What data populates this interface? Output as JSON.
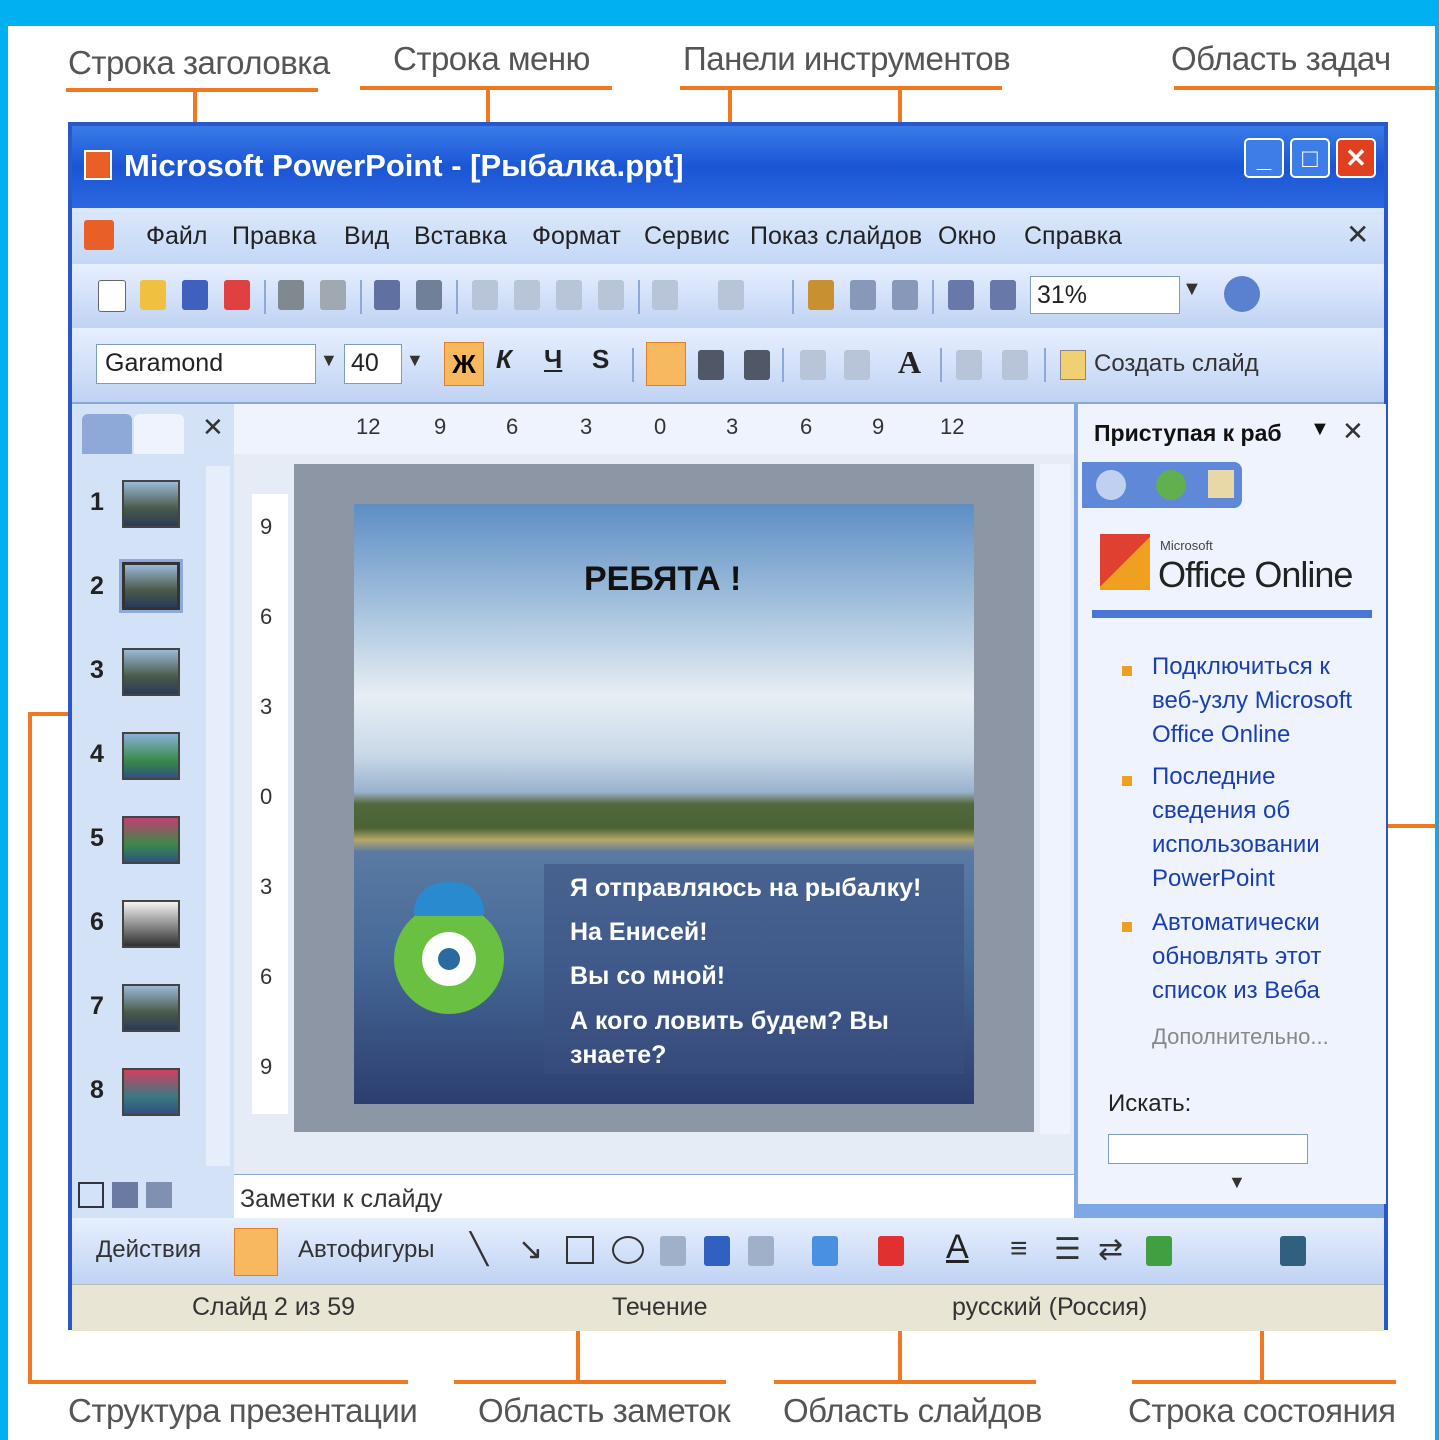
{
  "annotations": {
    "title_bar": "Строка заголовка",
    "menu_bar": "Строка меню",
    "toolbars": "Панели инструментов",
    "task_pane": "Область задач",
    "outline": "Структура презентации",
    "notes_area": "Область заметок",
    "slides_area": "Область слайдов",
    "status_bar": "Строка состояния"
  },
  "window": {
    "title": "Microsoft PowerPoint - [Рыбалка.ppt]"
  },
  "menu": [
    "Файл",
    "Правка",
    "Вид",
    "Вставка",
    "Формат",
    "Сервис",
    "Показ слайдов",
    "Окно",
    "Справка"
  ],
  "toolbar": {
    "zoom": "31%",
    "font": "Garamond",
    "size": "40",
    "bold": "Ж",
    "italic": "К",
    "underline": "Ч",
    "shadow": "S",
    "new_slide": "Создать слайд"
  },
  "ruler_h": [
    "12",
    "9",
    "6",
    "3",
    "0",
    "3",
    "6",
    "9",
    "12"
  ],
  "ruler_v": [
    "9",
    "6",
    "3",
    "0",
    "3",
    "6",
    "9"
  ],
  "slides": [
    "1",
    "2",
    "3",
    "4",
    "5",
    "6",
    "7",
    "8"
  ],
  "slide": {
    "title": "РЕБЯТА !",
    "bullets": [
      "Я отправляюсь на рыбалку!",
      "На Енисей!",
      "Вы со мной!",
      "А кого ловить будем? Вы знаете?"
    ]
  },
  "taskpane": {
    "title": "Приступая к раб",
    "brand_small": "Microsoft",
    "brand": "Office Online",
    "links": [
      "Подключиться к веб-узлу Microsoft Office Online",
      "Последние сведения об использовании PowerPoint",
      "Автоматически обновлять этот список из Веба"
    ],
    "more": "Дополнительно...",
    "search_label": "Искать:"
  },
  "notes_placeholder": "Заметки к слайду",
  "drawing": {
    "actions": "Действия",
    "autoshapes": "Автофигуры"
  },
  "status": {
    "slide": "Слайд 2 из 59",
    "design": "Течение",
    "language": "русский (Россия)"
  },
  "colors": {
    "frame": "#00b0f0",
    "arrow": "#f07820",
    "titlebar": "#1a55d4"
  }
}
